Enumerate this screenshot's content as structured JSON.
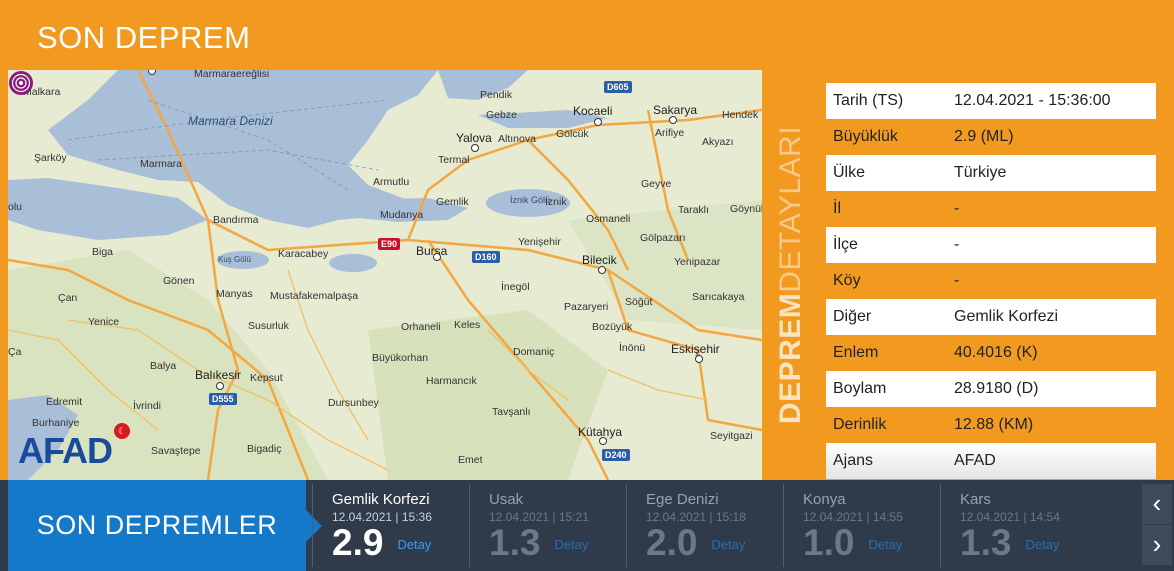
{
  "header": {
    "title": "SON DEPREM"
  },
  "map": {
    "sea_label": "Marmara Denizi",
    "lake_labels": [
      "İznik Gölü",
      "Kuş Gölü"
    ],
    "cities": [
      "Malkara",
      "Marmaraereğlisi",
      "Şarköy",
      "Marmara",
      "Bandırma",
      "Biga",
      "Çan",
      "Gönen",
      "Manyas",
      "Karacabey",
      "Mustafakemalpaşa",
      "Yenice",
      "Susurluk",
      "Balya",
      "Balıkesir",
      "Kepsut",
      "Edremit",
      "İvrindi",
      "Burhaniye",
      "Savaştepe",
      "Bigadiç",
      "Dursunbey",
      "Orhaneli",
      "Büyükorhan",
      "Keles",
      "Harmancık",
      "Tavşanlı",
      "Emet",
      "Kütahya",
      "Domaniç",
      "Bursa",
      "Mudanya",
      "Gemlik",
      "Armutlu",
      "Termal",
      "Yalova",
      "Altınova",
      "Gölcük",
      "Gebze",
      "Pendik",
      "Kocaeli",
      "Sakarya",
      "Arifiye",
      "Hendek",
      "Akyazı",
      "Geyve",
      "Taraklı",
      "Göynük",
      "Osmaneli",
      "İznik",
      "Yenişehir",
      "Gölpazarı",
      "Bilecik",
      "Yenipazar",
      "İnegöl",
      "Pazaryeri",
      "Söğüt",
      "Sarıcakaya",
      "Bozüyük",
      "İnönü",
      "Eskişehir",
      "Seyitgazi",
      "olu",
      "Ça"
    ],
    "roads": [
      "D605",
      "E90",
      "D160",
      "D555",
      "D240"
    ],
    "logo_text": "AFAD",
    "logo_flag_symbol": "☾"
  },
  "details": {
    "title_bold": "DEPREM",
    "title_light": "DETAYLARI",
    "rows": [
      {
        "key": "Tarih (TS)",
        "value": "12.04.2021 - 15:36:00"
      },
      {
        "key": "Büyüklük",
        "value": "2.9 (ML)"
      },
      {
        "key": "Ülke",
        "value": "Türkiye"
      },
      {
        "key": "İl",
        "value": "-"
      },
      {
        "key": "İlçe",
        "value": "-"
      },
      {
        "key": "Köy",
        "value": "-"
      },
      {
        "key": "Diğer",
        "value": "Gemlik Korfezi"
      },
      {
        "key": "Enlem",
        "value": "40.4016 (K)"
      },
      {
        "key": "Boylam",
        "value": "28.9180 (D)"
      },
      {
        "key": "Derinlik",
        "value": "12.88 (KM)"
      },
      {
        "key": "Ajans",
        "value": "AFAD"
      }
    ]
  },
  "recent": {
    "title": "SON DEPREMLER",
    "items": [
      {
        "place": "Gemlik Korfezi",
        "time": "12.04.2021 | 15:36",
        "magnitude": "2.9",
        "link": "Detay"
      },
      {
        "place": "Usak",
        "time": "12.04.2021 | 15:21",
        "magnitude": "1.3",
        "link": "Detay"
      },
      {
        "place": "Ege Denizi",
        "time": "12.04.2021 | 15:18",
        "magnitude": "2.0",
        "link": "Detay"
      },
      {
        "place": "Konya",
        "time": "12.04.2021 | 14:55",
        "magnitude": "1.0",
        "link": "Detay"
      },
      {
        "place": "Kars",
        "time": "12.04.2021 | 14:54",
        "magnitude": "1.3",
        "link": "Detay"
      }
    ],
    "prev_symbol": "‹",
    "next_symbol": "›"
  },
  "colors": {
    "brand_orange": "#f29a1f",
    "accent_blue": "#1479c9",
    "bar_dark": "#2f3b4a",
    "quake_marker": "#8b1a7a"
  }
}
